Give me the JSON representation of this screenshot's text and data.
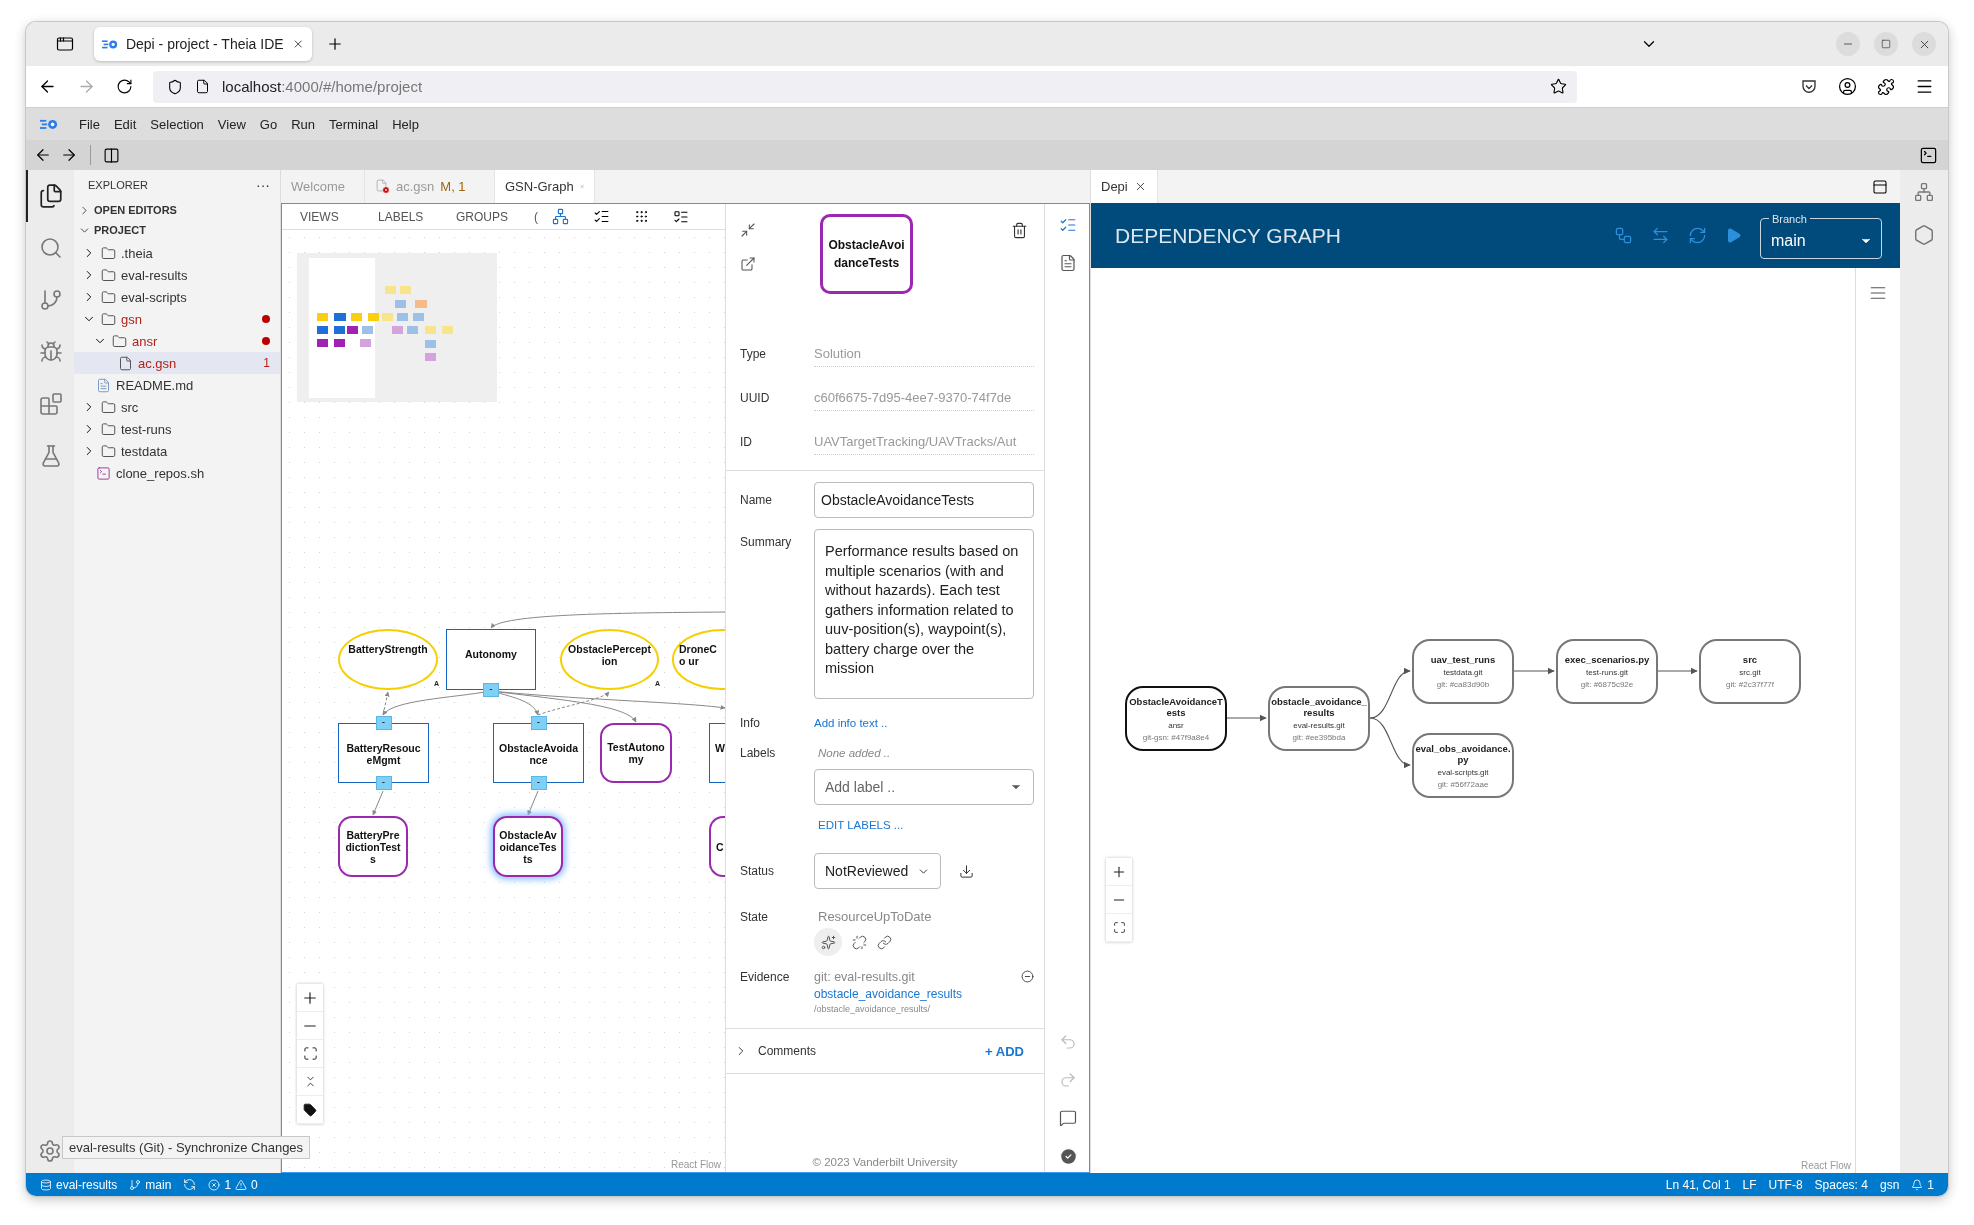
{
  "browser": {
    "tab": {
      "title": "Depi - project - Theia IDE",
      "selected": true
    },
    "url": {
      "host": "localhost",
      "rest": ":4000/#/home/project"
    }
  },
  "menu": [
    "File",
    "Edit",
    "Selection",
    "View",
    "Go",
    "Run",
    "Terminal",
    "Help"
  ],
  "explorer": {
    "title": "EXPLORER",
    "more": "···",
    "sections": [
      {
        "label": "OPEN EDITORS",
        "expanded": false
      },
      {
        "label": "PROJECT",
        "expanded": true
      }
    ],
    "tree": [
      {
        "label": ".theia",
        "kind": "folder",
        "expanded": false,
        "selected": false,
        "problems": false
      },
      {
        "label": "eval-results",
        "kind": "folder",
        "expanded": false,
        "selected": false,
        "problems": false
      },
      {
        "label": "eval-scripts",
        "kind": "folder",
        "expanded": false,
        "selected": false,
        "problems": false
      },
      {
        "label": "gsn",
        "kind": "folder",
        "expanded": true,
        "selected": false,
        "problems": true,
        "children": [
          {
            "label": "ansr",
            "kind": "folder",
            "expanded": true,
            "selected": false,
            "problems": true,
            "children": [
              {
                "label": "ac.gsn",
                "kind": "file",
                "selected": true,
                "problems": true,
                "badge": "1"
              }
            ]
          }
        ]
      },
      {
        "label": "README.md",
        "kind": "markdown",
        "selected": false,
        "problems": false
      },
      {
        "label": "src",
        "kind": "folder",
        "expanded": false,
        "selected": false,
        "problems": false
      },
      {
        "label": "test-runs",
        "kind": "folder",
        "expanded": false,
        "selected": false,
        "problems": false
      },
      {
        "label": "testdata",
        "kind": "folder",
        "expanded": false,
        "selected": false,
        "problems": false
      },
      {
        "label": "clone_repos.sh",
        "kind": "script",
        "selected": false,
        "problems": false
      }
    ]
  },
  "editor_tabs": [
    {
      "label": "Welcome",
      "selected": false,
      "problem": false
    },
    {
      "label": "ac.gsn",
      "status": "M, 1",
      "selected": false,
      "problem": true
    },
    {
      "label": "GSN-Graph",
      "selected": true,
      "problem": false
    }
  ],
  "gsn": {
    "toolbar_tabs": [
      "VIEWS",
      "LABELS",
      "GROUPS",
      "("
    ],
    "nodes": [
      {
        "kind": "goal",
        "label": "BatteryStrength",
        "marker": "A",
        "selected": false
      },
      {
        "kind": "strategy",
        "label": "Autonomy",
        "bottom_handle": "-",
        "selected": false
      },
      {
        "kind": "goal",
        "label": "ObstaclePerception",
        "marker": "A",
        "selected": false
      },
      {
        "kind": "goal",
        "label": "DroneCo ur",
        "selected": false
      },
      {
        "kind": "strategy",
        "label": "BatteryResouceMgmt",
        "top_handle": "-",
        "bottom_handle": "-",
        "selected": false
      },
      {
        "kind": "strategy",
        "label": "ObstacleAvoidance",
        "top_handle": "-",
        "bottom_handle": "-",
        "selected": false
      },
      {
        "kind": "solution",
        "label": "TestAutonomy",
        "selected": false
      },
      {
        "kind": "strategy",
        "label": "W",
        "selected": false
      },
      {
        "kind": "solution",
        "label": "BatteryPredictionTests",
        "selected": false
      },
      {
        "kind": "solution",
        "label": "ObstacleAvoidanceTests",
        "selected": true
      },
      {
        "kind": "solution",
        "label": "C",
        "selected": false
      }
    ],
    "attribution": "React Flow"
  },
  "properties": {
    "preview": "ObstacleAvoidanceTests",
    "fields": [
      {
        "label": "Type",
        "value": "Solution"
      },
      {
        "label": "UUID",
        "value": "c60f6675-7d95-4ee7-9370-74f7de"
      },
      {
        "label": "ID",
        "value": "UAVTargetTracking/UAVTracks/Aut"
      }
    ],
    "name": {
      "label": "Name",
      "value": "ObstacleAvoidanceTests"
    },
    "summary": {
      "label": "Summary",
      "value": "Performance results based on multiple scenarios (with and without hazards). Each test gathers information related to uuv-position(s), waypoint(s), battery charge over the mission"
    },
    "info": {
      "label": "Info",
      "link": "Add info text .."
    },
    "labels": {
      "label": "Labels",
      "empty": "None added ..",
      "placeholder": "Add label ..",
      "edit": "EDIT LABELS ..."
    },
    "status": {
      "label": "Status",
      "value": "NotReviewed"
    },
    "state": {
      "label": "State",
      "value": "ResourceUpToDate"
    },
    "evidence": {
      "label": "Evidence",
      "repo": "git: eval-results.git",
      "link": "obstacle_avoidance_results",
      "path": "/obstacle_avoidance_results/"
    },
    "comments": {
      "label": "Comments",
      "expanded": false,
      "add": "+ ADD"
    },
    "footer": "© 2023 Vanderbilt University"
  },
  "depi": {
    "tab": "Depi",
    "title": "DEPENDENCY GRAPH",
    "branch": {
      "label": "Branch",
      "value": "main"
    },
    "nodes": [
      {
        "title": "ObstacleAvoidanceTests",
        "repo": "ansr",
        "commit": "git-gsn: #47f9a8e4",
        "selected": true
      },
      {
        "title": "obstacle_avoidance_results",
        "repo": "eval-results.git",
        "commit": "git: #ee395bda",
        "selected": false
      },
      {
        "title": "uav_test_runs",
        "repo": "testdata.git",
        "commit": "git: #ca83d90b",
        "selected": false
      },
      {
        "title": "exec_scenarios.py",
        "repo": "test-runs.git",
        "commit": "git: #6875c92e",
        "selected": false
      },
      {
        "title": "src",
        "repo": "src.git",
        "commit": "git: #2c37f77f",
        "selected": false
      },
      {
        "title": "eval_obs_avoidance.py",
        "repo": "eval-scripts.git",
        "commit": "git: #56f72aae",
        "selected": false
      }
    ],
    "attribution": "React Flow"
  },
  "tooltip": "eval-results (Git) - Synchronize Changes",
  "status_bar": {
    "left": [
      {
        "kind": "repo",
        "text": "eval-results"
      },
      {
        "kind": "branch",
        "text": "main"
      },
      {
        "kind": "sync"
      },
      {
        "kind": "problems",
        "errors": "1",
        "warnings": "0"
      }
    ],
    "right": [
      "Ln 41, Col 1",
      "LF",
      "UTF-8",
      "Spaces: 4",
      "gsn"
    ],
    "notifications": "1"
  }
}
